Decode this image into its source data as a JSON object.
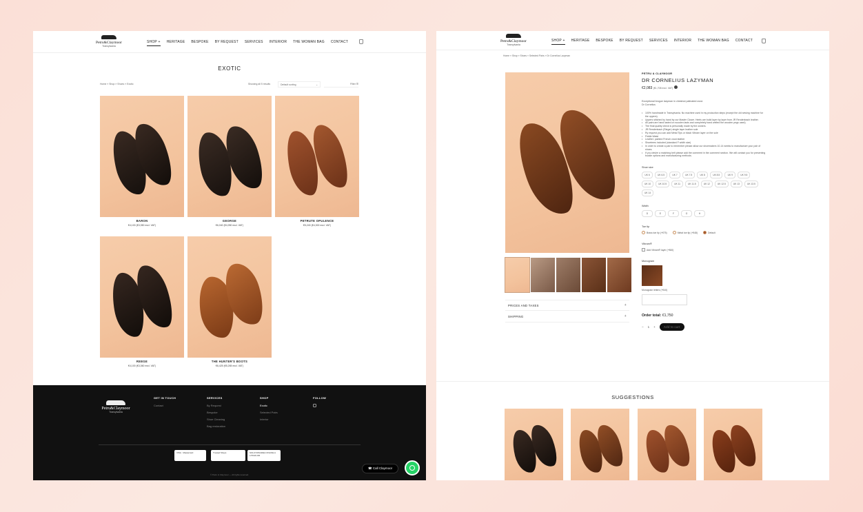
{
  "header": {
    "brand": "Petru&Claymoor",
    "sub": "Transylvania",
    "nav": [
      "SHOP +",
      "HERITAGE",
      "BESPOKE",
      "BY REQUEST",
      "SERVICES",
      "INTERIOR",
      "THE WOMAN BAG",
      "CONTACT"
    ]
  },
  "category": {
    "title": "EXOTIC",
    "breadcrumb": "Home » Shop » Shoes » Exotic",
    "result_count": "Showing all 5 results",
    "sort": "Default sorting",
    "filter": "Filter",
    "products": [
      {
        "name": "BARON",
        "price": "€4,100 (€3,350 excl. VAT)"
      },
      {
        "name": "GEORGE",
        "price": "€6,040 (€4,950 excl. VAT)"
      },
      {
        "name": "PETRUTE OPULENCE",
        "price": "€5,240 (€4,300 excl. VAT)"
      },
      {
        "name": "REEGE",
        "price": "€4,100 (€3,360 excl. VAT)"
      },
      {
        "name": "THE HUNTER'S BOOTS",
        "price": "€6,425 (€5,265 excl. VAT)"
      }
    ]
  },
  "footer": {
    "brand": "Petru&Claymoor",
    "sub": "Transylvania",
    "get_in_touch": {
      "title": "GET IN TOUCH",
      "items": [
        "Contact"
      ]
    },
    "services": {
      "title": "SERVICES",
      "items": [
        "By Request",
        "Bespoke",
        "Shoe Cleaning",
        "Bag restoration"
      ]
    },
    "shop": {
      "title": "SHOP",
      "items": [
        "Exotic",
        "Selected Pairs",
        "Interior"
      ]
    },
    "follow": {
      "title": "FOLLOW"
    },
    "badges": [
      "VISA · Mastercard",
      "Trusted Shops",
      "SOLUȚIONAREA ONLINE A LITIGIILOR"
    ],
    "copyright": "© Petru & Claymoor — All rights reserved.",
    "call_label": "Call Claymoor"
  },
  "product": {
    "breadcrumb": "Home » Shop » Shoes » Selected Pairs » Dr Cornelius Lazyman",
    "maker": "PETRU & CLAYMOOR",
    "title": "DR CORNELIUS LAZYMAN",
    "price": "€2,083",
    "price_excl": "(€1,708 excl. VAT)",
    "desc1": "Exceptional brogue lazyman in chestnut patinated crust.",
    "desc2": "Dr Cornelius",
    "bullets": [
      "100% handmade in Transylvania. No machine used in my production steps (except the old sewing machine for the uppers).",
      "Uppers stitched by hand by our Master Closer. Heels are build layer by layer from JR Rendenbach leather.",
      "All pairs are hand lasted on wooden lasts and completely hand welted the wooden pegs used).",
      "The final quality check is personally made by the owners.",
      "JR Rendenbach (Rieger) single layer leather sole",
      "Ry request you can add Metal Tips or black Vibram layer on the sole",
      "Fiddle Waist",
      "Leather: painted French crust leather",
      "Shoetrees included (standard F width size)",
      "In order to create a pair to remember please allow our shoemakers 10-14 weeks to manufacture your pair of shoes.",
      "If you desire a matching belt please add the comment in the comment section. We will contact you for presenting buckle options and manufacturing methods."
    ],
    "shoe_size_label": "Shoe size",
    "sizes": [
      "UK 6",
      "UK 6.5",
      "UK 7",
      "UK 7.5",
      "UK 8",
      "UK 8.5",
      "UK 9",
      "UK 9.5",
      "UK 10",
      "UK 10.5",
      "UK 11",
      "UK 11.5",
      "UK 12",
      "UK 12.5",
      "UK 13",
      "UK 13.5",
      "UK 14"
    ],
    "width_label": "Width",
    "widths": [
      "D",
      "E",
      "F",
      "G",
      "H"
    ],
    "toe_tip_label": "Toe tip",
    "toe_tips": [
      "Brass toe tip (+€75)",
      "Metal toe tip (+€48)",
      "Default"
    ],
    "vibram_label": "Vibram®",
    "vibram_option": "Add Vibram® layer (+€60)",
    "monogram_label": "Monogram",
    "monogram_letters": "Monogram letters (+€40)",
    "accordion": [
      "PRICES AND TAXES",
      "SHIPPING"
    ],
    "order_total_label": "Order total:",
    "order_total": "€1,750",
    "qty": "1",
    "add_to_cart": "Add to cart",
    "suggestions_title": "SUGGESTIONS"
  },
  "colors": {
    "accent": "#111111",
    "bg": "#fbe3db",
    "shoe_bg": "#f4c6a0"
  }
}
